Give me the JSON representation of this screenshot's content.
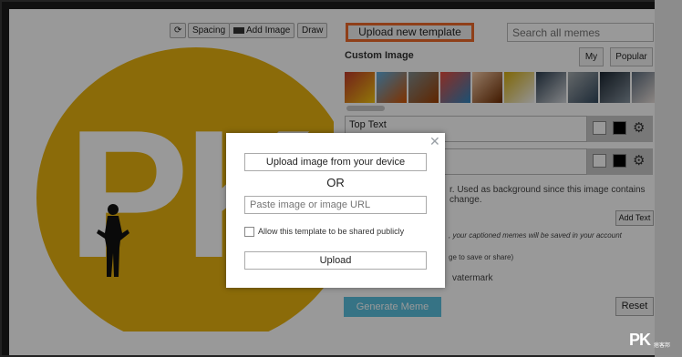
{
  "toolbar": {
    "rotate_icon": "rotate-icon",
    "spacing_label": "Spacing",
    "add_image_label": "Add Image",
    "draw_label": "Draw"
  },
  "canvas": {
    "logo_letter": "PK",
    "circle_color": "#e8b20f"
  },
  "panel": {
    "upload_template_label": "Upload new template",
    "search_placeholder": "Search all memes",
    "custom_image_label": "Custom Image",
    "tabs": [
      {
        "label": "My"
      },
      {
        "label": "Popular"
      }
    ],
    "text_boxes": [
      {
        "value": "Top Text"
      },
      {
        "value": ""
      }
    ],
    "background_note": "r. Used as background since this image contains\nchange.",
    "add_text_label": "Add Text",
    "saved_note": ", your captioned memes will be saved in your account",
    "save_share_note": "ge to save or share)",
    "watermark_label": "vatermark",
    "generate_label": "Generate Meme",
    "reset_label": "Reset",
    "accent_color": "#5bc0de",
    "highlight_color": "#ee6a2a"
  },
  "modal": {
    "upload_device_label": "Upload image from your device",
    "or_label": "OR",
    "paste_placeholder": "Paste image or image URL",
    "share_publicly_label": "Allow this template to be shared publicly",
    "upload_label": "Upload",
    "close_icon": "close-icon"
  },
  "watermark_logo": {
    "text": "PK",
    "sub": "痞客邦"
  }
}
